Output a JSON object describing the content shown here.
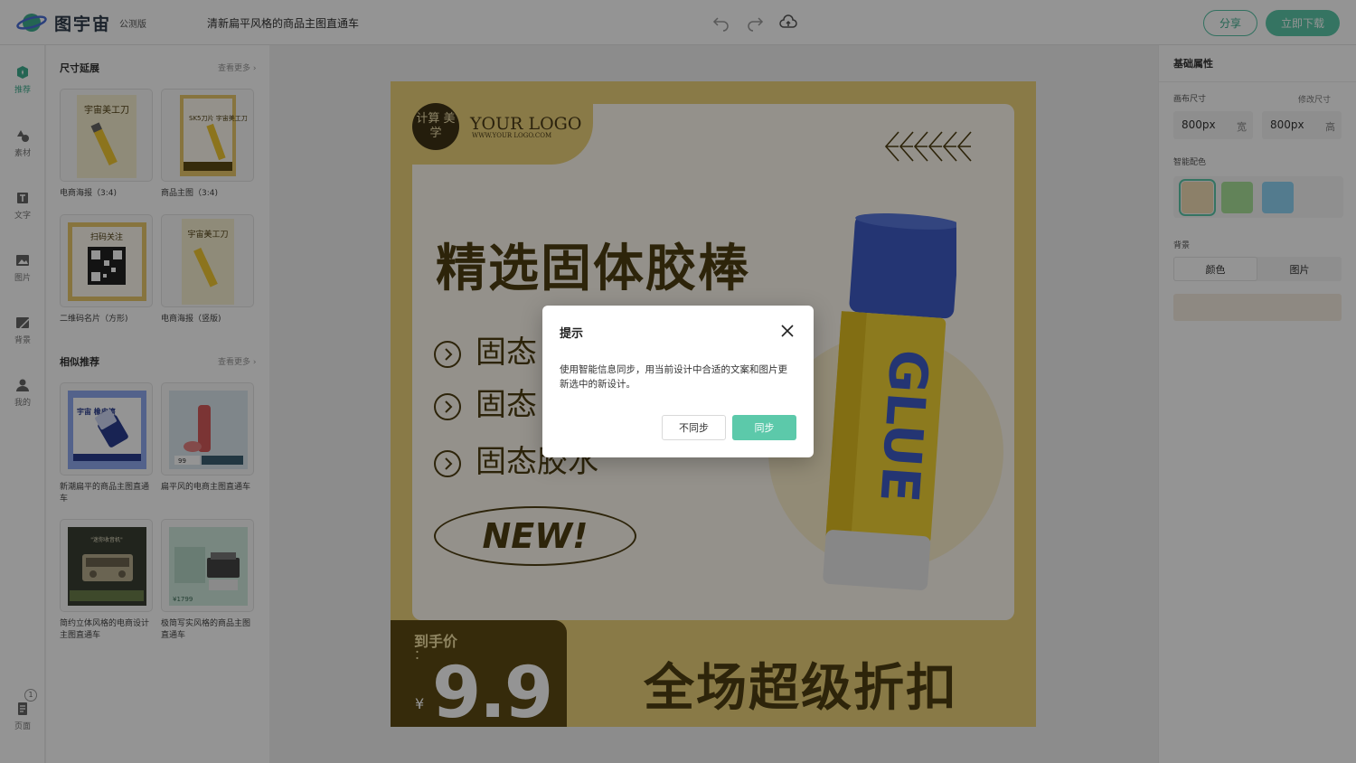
{
  "app": {
    "name": "图宇宙",
    "badge": "公测版",
    "doc_title": "清新扁平风格的商品主图直通车",
    "brand_color": "#5cc9aa"
  },
  "toolbar": {
    "undo_icon": "undo-icon",
    "redo_icon": "redo-icon",
    "cloud_icon": "cloud-upload-icon",
    "share_label": "分享",
    "download_label": "立即下载"
  },
  "rail": {
    "items": [
      {
        "label": "推荐",
        "icon": "recommend-icon"
      },
      {
        "label": "素材",
        "icon": "shapes-icon"
      },
      {
        "label": "文字",
        "icon": "text-icon"
      },
      {
        "label": "图片",
        "icon": "image-icon"
      },
      {
        "label": "背景",
        "icon": "background-icon"
      },
      {
        "label": "我的",
        "icon": "user-icon"
      }
    ],
    "pages_label": "页面",
    "pages_count": "1"
  },
  "panel": {
    "size_section": {
      "title": "尺寸延展",
      "more": "查看更多 ›",
      "cards": [
        {
          "label": "电商海报（3:4)",
          "thumb_text": "宇宙美工刀"
        },
        {
          "label": "商品主图（3:4)",
          "thumb_text": "SK5刀片 宇宙美工刀"
        },
        {
          "label": "二维码名片（方形)",
          "thumb_text": "扫码关注"
        },
        {
          "label": "电商海报（竖版)",
          "thumb_text": "宇宙美工刀"
        }
      ]
    },
    "similar_section": {
      "title": "相似推荐",
      "more": "查看更多 ›",
      "cards": [
        {
          "label": "新潮扁平的商品主图直通车",
          "thumb_text": "宇宙 橡皮擦"
        },
        {
          "label": "扁平风的电商主图直通车",
          "thumb_text": "99"
        },
        {
          "label": "简约立体风格的电商设计主图直通车",
          "thumb_text": "\"迷你收音机\""
        },
        {
          "label": "极简写实风格的商品主图直通车",
          "thumb_text": "¥1799"
        }
      ]
    }
  },
  "poster": {
    "seal_text": "计算 美学",
    "logo": "YOUR LOGO",
    "logo_sub": "WWW.YOUR LOGO.COM",
    "headline": "精选固体胶棒",
    "features": [
      "固态",
      "固态",
      "固态胶水"
    ],
    "new_badge": "NEW!",
    "price_label": "到手价",
    "price_colon": "：",
    "currency": "¥",
    "price": "9.9",
    "promo": "全场超级折扣",
    "product_text": "GLUE",
    "colors": {
      "bg": "#ecd27a",
      "dark": "#4f3f12",
      "cap": "#3e5cc7",
      "tube": "#f2d335"
    }
  },
  "props": {
    "title": "基础属性",
    "canvas_size_label": "画布尺寸",
    "edit_size_link": "修改尺寸",
    "width_value": "800px",
    "width_unit": "宽",
    "height_value": "800px",
    "height_unit": "高",
    "palette_label": "智能配色",
    "palette": [
      "#f1ddb5",
      "#a9e29a",
      "#8fd5f5"
    ],
    "bg_label": "背景",
    "bg_tabs": [
      "颜色",
      "图片"
    ],
    "bg_color": "#f5ede0"
  },
  "modal": {
    "title": "提示",
    "body": "使用智能信息同步，用当前设计中合适的文案和图片更新选中的新设计。",
    "cancel": "不同步",
    "confirm": "同步"
  }
}
